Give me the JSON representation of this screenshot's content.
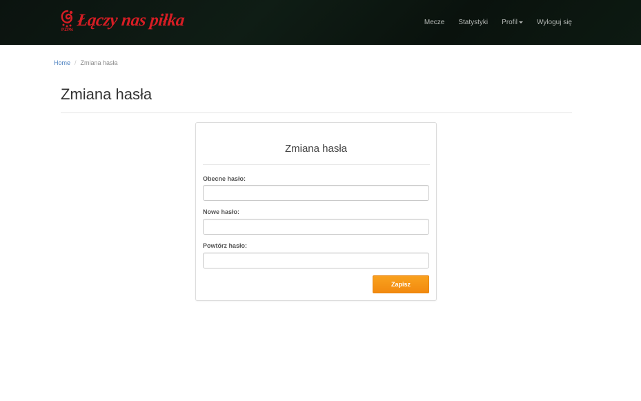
{
  "brand": {
    "text": "Łączy nas piłka",
    "emblem_label": "PZPN",
    "color": "#d51d24"
  },
  "nav": {
    "items": [
      "Mecze",
      "Statystyki",
      "Profil",
      "Wyloguj się"
    ]
  },
  "breadcrumb": {
    "home": "Home",
    "separator": "/",
    "current": "Zmiana hasła"
  },
  "page": {
    "title": "Zmiana hasła"
  },
  "form": {
    "title": "Zmiana hasła",
    "fields": [
      {
        "label": "Obecne hasło:",
        "value": ""
      },
      {
        "label": "Nowe hasło:",
        "value": ""
      },
      {
        "label": "Powtórz hasło:",
        "value": ""
      }
    ],
    "submit_label": "Zapisz",
    "submit_color": "#f7941d"
  },
  "colors": {
    "navbar_bg": "#0c1610",
    "link": "#4a7fbf"
  }
}
